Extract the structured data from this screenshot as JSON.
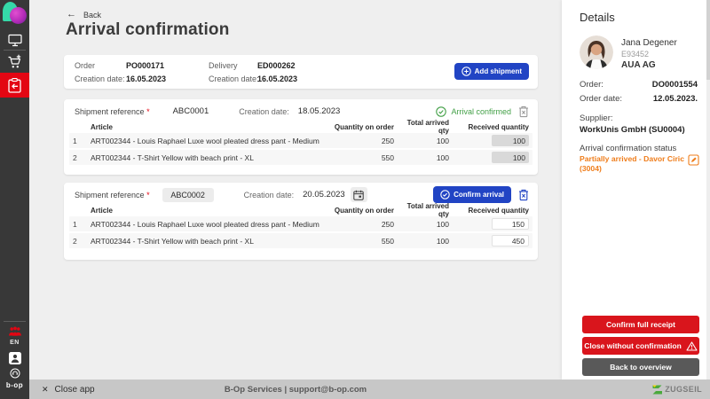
{
  "sidebar": {
    "language": "EN",
    "brand": "b-op"
  },
  "header": {
    "back_label": "Back",
    "title": "Arrival confirmation"
  },
  "order_card": {
    "order_label": "Order",
    "order_number": "PO000171",
    "creation_date_label": "Creation date:",
    "creation_date": "16.05.2023",
    "delivery_label": "Delivery",
    "delivery_number": "ED000262",
    "delivery_creation_date_label": "Creation date:",
    "delivery_creation_date": "16.05.2023",
    "add_shipment_label": "Add shipment"
  },
  "table_headers": {
    "article": "Article",
    "qty_on_order": "Quantity on order",
    "total_arrived": "Total arrived qty",
    "received": "Received quantity"
  },
  "shipments": [
    {
      "reference_label": "Shipment reference",
      "required_marker": "*",
      "reference": "ABC0001",
      "creation_date_label": "Creation date:",
      "creation_date": "18.05.2023",
      "status_label": "Arrival confirmed",
      "rows": [
        {
          "num": "1",
          "article": "ART002344 - Louis Raphael Luxe wool pleated dress pant - Medium",
          "qty_on_order": "250",
          "total_arrived": "100",
          "received": "100"
        },
        {
          "num": "2",
          "article": "ART002344 - T-Shirt Yellow with beach print - XL",
          "qty_on_order": "550",
          "total_arrived": "100",
          "received": "100"
        }
      ]
    },
    {
      "reference_label": "Shipment reference",
      "required_marker": "*",
      "reference": "ABC0002",
      "creation_date_label": "Creation date:",
      "creation_date": "20.05.2023",
      "confirm_label": "Confirm arrival",
      "rows": [
        {
          "num": "1",
          "article": "ART002344 - Louis Raphael Luxe wool pleated dress pant - Medium",
          "qty_on_order": "250",
          "total_arrived": "100",
          "received": "150"
        },
        {
          "num": "2",
          "article": "ART002344 - T-Shirt Yellow with beach print - XL",
          "qty_on_order": "550",
          "total_arrived": "100",
          "received": "450"
        }
      ]
    }
  ],
  "details": {
    "title": "Details",
    "user": {
      "name": "Jana Degener",
      "employee_id": "E93452",
      "company": "AUA AG"
    },
    "order_label": "Order:",
    "order_number": "DO0001554",
    "order_date_label": "Order date:",
    "order_date": "12.05.2023.",
    "supplier_label": "Supplier:",
    "supplier": "WorkUnis GmbH (SU0004)",
    "status_label": "Arrival confirmation status",
    "status_value": "Partially arrived - Davor Ciric (3004)",
    "confirm_full_label": "Confirm full receipt",
    "close_without_label": "Close without confirmation",
    "back_overview_label": "Back to overview"
  },
  "footer": {
    "close_app_label": "Close app",
    "support_text": "B-Op Services | support@b-op.com",
    "brand": "ZUGSEIL"
  },
  "icons": {
    "back_arrow": "←",
    "close_x": "✕"
  },
  "colors": {
    "accent_blue": "#2144c4",
    "sidebar_active_red": "#e30613",
    "button_red": "#d9151c",
    "button_grey": "#595959",
    "confirmed_green": "#43a047",
    "status_orange": "#ef7d1b",
    "sidebar_bg": "#383838",
    "footer_bg": "#c7c7c7",
    "main_bg": "#efefef"
  }
}
